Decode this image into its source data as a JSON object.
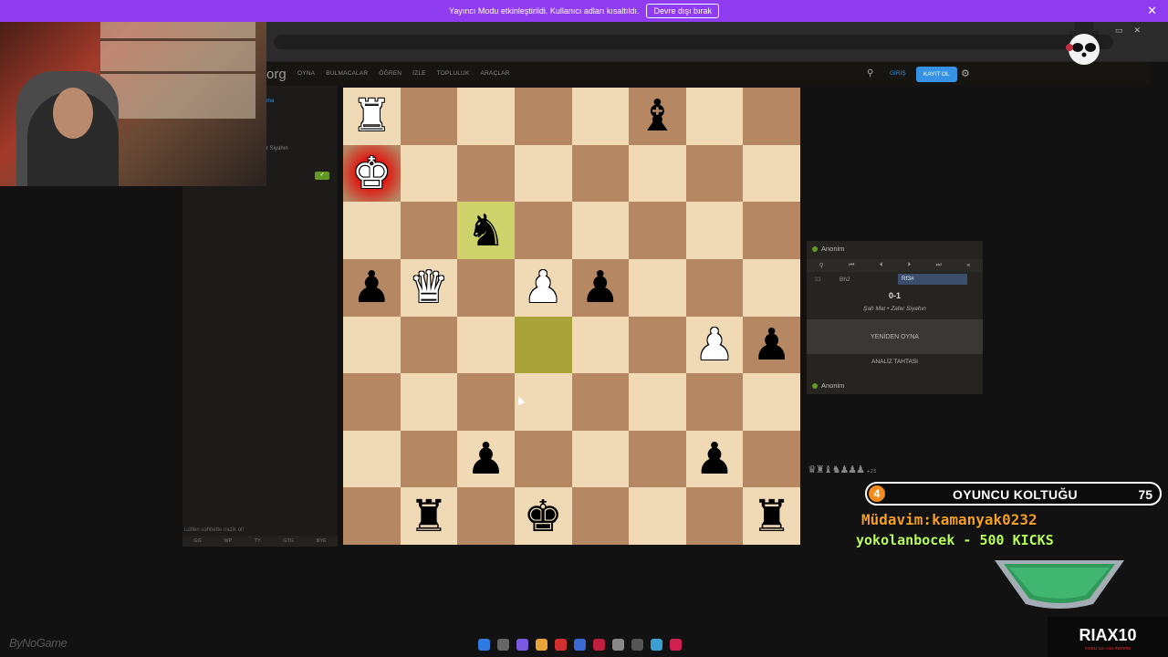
{
  "banner": {
    "message": "Yayıncı Modu etkinleştirildi. Kullanıcı adları kısaltıldı.",
    "button_label": "Devre dışı bırak",
    "close_glyph": "✕"
  },
  "site": {
    "logo_text": "org",
    "nav": [
      "OYNA",
      "BULMACALAR",
      "ÖĞREN",
      "İZLE",
      "TOPLULUK",
      "ARAÇLAR"
    ],
    "login_label": "GİRİŞ",
    "signup_label": "KAYIT OL",
    "search_icon": "search-icon",
    "settings_icon": "gear-icon"
  },
  "left_panel": {
    "game_link": "ma",
    "opponent_label": "r Siyahın",
    "chat_placeholder": "Lütfen sohbette nazik ol!",
    "chat_presets": [
      "GG",
      "WP",
      "TY",
      "GTG",
      "BYE"
    ]
  },
  "board": {
    "orientation": "white-bottom-mirrored",
    "squares": [
      [
        "wR",
        "",
        "",
        "",
        "",
        "bB",
        "",
        ""
      ],
      [
        "wK*",
        "",
        "",
        "",
        "",
        "",
        "",
        ""
      ],
      [
        "",
        "",
        "bN+",
        "",
        "",
        "",
        "",
        ""
      ],
      [
        "bP",
        "wQ_b",
        "",
        "wP",
        "bP",
        "",
        "",
        ""
      ],
      [
        "",
        "",
        "",
        "+",
        "",
        "",
        "wP",
        "bP"
      ],
      [
        "",
        "",
        "",
        "",
        "",
        "",
        "",
        ""
      ],
      [
        "",
        "",
        "bP",
        "",
        "",
        "",
        "bP",
        ""
      ],
      [
        "",
        "bR",
        "",
        "bK",
        "",
        "",
        "",
        "bR"
      ]
    ]
  },
  "move_panel": {
    "top_player": "Anonim",
    "bottom_player": "Anonim",
    "move_number": "33",
    "white_move": "Bh2",
    "black_move": "Rf3#",
    "result": "0-1",
    "status": "Şah Mat • Zafer Siyahın",
    "rematch_label": "YENİDEN OYNA",
    "analysis_label": "ANALİZ TAHTASI",
    "captured_glyphs": "♛♜♝♞♟♟♟",
    "captured_diff": "+23"
  },
  "overlay": {
    "seat_number": "4",
    "seat_title": "OYUNCU KOLTUĞU",
    "seat_count": "75",
    "ticker_regular": "Müdavim:kamanyak0232",
    "ticker_kicks": "yokolanbocek - 500 KICKS",
    "streamer_name": "RIAX10",
    "streamer_sub": "KODU İLE %10 İNDİRİM",
    "sponsor": "ByNoGame"
  },
  "colors": {
    "banner": "#8f3bf0",
    "board_light": "#f0d9b5",
    "board_dark": "#b58863",
    "highlight": "#cdd26a",
    "accent": "#3692e7",
    "online": "#629924"
  }
}
